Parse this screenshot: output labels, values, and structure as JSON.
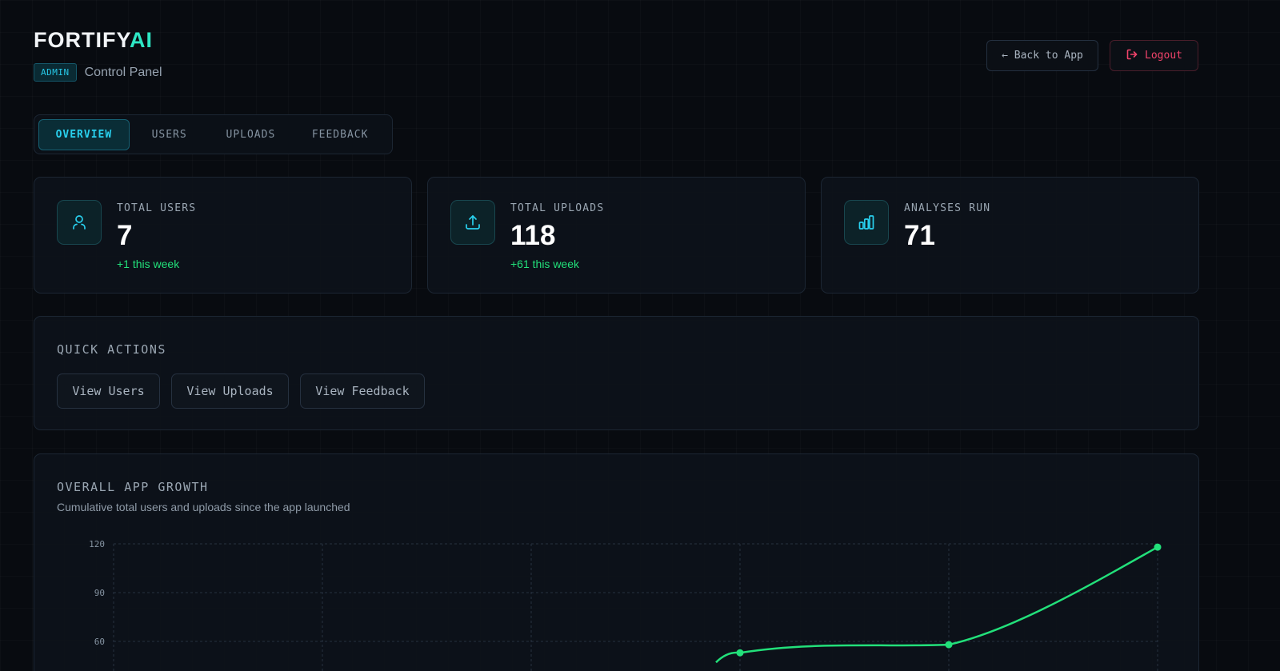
{
  "brand": {
    "name": "FORTIFY",
    "accent": "AI"
  },
  "header": {
    "badge": "ADMIN",
    "subtitle": "Control Panel",
    "back_label": "← Back to App",
    "logout_label": "Logout"
  },
  "tabs": [
    {
      "label": "OVERVIEW",
      "active": true
    },
    {
      "label": "USERS",
      "active": false
    },
    {
      "label": "UPLOADS",
      "active": false
    },
    {
      "label": "FEEDBACK",
      "active": false
    }
  ],
  "stats": [
    {
      "label": "TOTAL USERS",
      "value": "7",
      "delta": "+1 this week",
      "icon": "user-icon"
    },
    {
      "label": "TOTAL UPLOADS",
      "value": "118",
      "delta": "+61 this week",
      "icon": "upload-icon"
    },
    {
      "label": "ANALYSES RUN",
      "value": "71",
      "delta": "",
      "icon": "bar-chart-icon"
    }
  ],
  "quick_actions": {
    "title": "QUICK ACTIONS",
    "buttons": [
      "View Users",
      "View Uploads",
      "View Feedback"
    ]
  },
  "growth": {
    "title": "OVERALL APP GROWTH",
    "description": "Cumulative total users and uploads since the app launched"
  },
  "colors": {
    "accent_cyan": "#29d0ee",
    "accent_teal": "#2ee6c4",
    "success_green": "#22e07a",
    "danger_red": "#f0436a"
  },
  "chart_data": {
    "type": "line",
    "title": "",
    "xlabel": "",
    "ylabel": "",
    "yticks": [
      120,
      90,
      60
    ],
    "ylim": [
      0,
      120
    ],
    "grid": true,
    "series": [
      {
        "name": "",
        "color": "#22e07a",
        "x": [
          3,
          4,
          5
        ],
        "values": [
          53,
          58,
          118
        ]
      }
    ],
    "x_count": 6
  }
}
